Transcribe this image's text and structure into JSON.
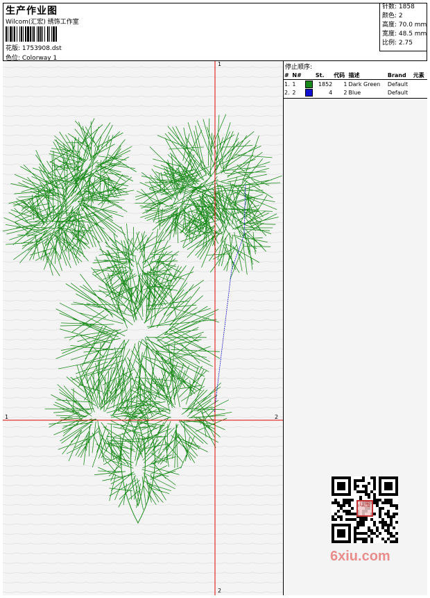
{
  "header": {
    "title": "生产作业图",
    "studio": "Wilcom(汇宏) 绣饰工作室",
    "design_file": "花版: 1753908.dst",
    "colorway": "色位: Colorway 1"
  },
  "stats": {
    "stitches": "针数: 1858",
    "colors": "颜色: 2",
    "height": "高度: 70.0 mm",
    "width": "宽度: 48.5 mm",
    "scale": "比例: 2.75"
  },
  "axes": {
    "top": "1",
    "bottom": "2",
    "left": "1",
    "right": "2"
  },
  "stop_sequence": {
    "title": "停止顺序:",
    "headers": [
      "#",
      "N#",
      "St.",
      "代码",
      "描述",
      "Brand",
      "元素"
    ],
    "rows": [
      {
        "index": "1.",
        "n": "1",
        "color": "#1a8a1a",
        "stitches": "1852",
        "code": "1",
        "description": "Dark Green",
        "brand": "Default"
      },
      {
        "index": "2.",
        "n": "2",
        "color": "#1010d0",
        "stitches": "4",
        "code": "2",
        "description": "Blue",
        "brand": "Default"
      }
    ]
  },
  "watermark": {
    "text": "6xiu.com",
    "stamp": "以图"
  },
  "colors": {
    "thread_green": "#1a8a1a",
    "thread_blue": "#1010d0",
    "axis_red": "#e00000"
  }
}
